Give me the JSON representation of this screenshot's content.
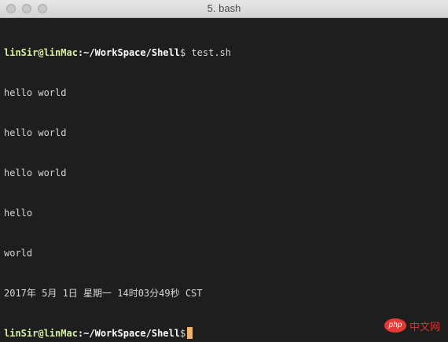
{
  "window": {
    "title": "5. bash"
  },
  "terminal": {
    "prompt_user": "linSir@linMac",
    "prompt_path": ":~/WorkSpace/Shell",
    "prompt_symbol": "$",
    "command": " test.sh",
    "output": [
      "hello world",
      "hello world",
      "hello world",
      "hello",
      "world",
      "2017年 5月 1日 星期一 14时03分49秒 CST"
    ]
  },
  "watermark": {
    "badge": "php",
    "text": "中文网"
  },
  "colors": {
    "background": "#1e1e1e",
    "prompt_user": "#d7f0a0",
    "cursor": "#f2b36b",
    "watermark": "#e53935"
  }
}
